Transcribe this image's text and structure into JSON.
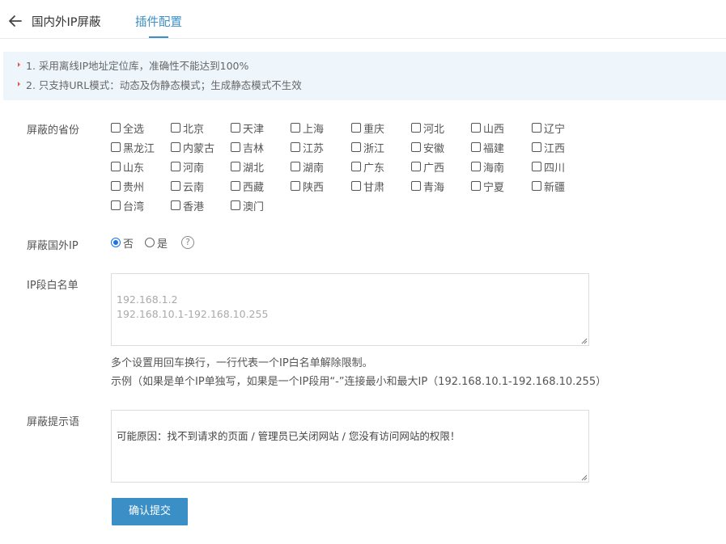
{
  "header": {
    "title": "国内外IP屏蔽",
    "tab_label": "插件配置"
  },
  "notice": {
    "items": [
      "1. 采用离线IP地址定位库，准确性不能达到100%",
      "2. 只支持URL模式：动态及伪静态模式；生成静态模式不生效"
    ]
  },
  "provinces": {
    "label": "屏蔽的省份",
    "options": [
      "全选",
      "北京",
      "天津",
      "上海",
      "重庆",
      "河北",
      "山西",
      "辽宁",
      "黑龙江",
      "内蒙古",
      "吉林",
      "江苏",
      "浙江",
      "安徽",
      "福建",
      "江西",
      "山东",
      "河南",
      "湖北",
      "湖南",
      "广东",
      "广西",
      "海南",
      "四川",
      "贵州",
      "云南",
      "西藏",
      "陕西",
      "甘肃",
      "青海",
      "宁夏",
      "新疆",
      "台湾",
      "香港",
      "澳门"
    ]
  },
  "foreign": {
    "label": "屏蔽国外IP",
    "options": [
      "否",
      "是"
    ],
    "selected": "否",
    "help": "?"
  },
  "whitelist": {
    "label": "IP段白名单",
    "placeholder": "192.168.1.2\n192.168.10.1-192.168.10.255",
    "hint1": "多个设置用回车换行，一行代表一个IP白名单解除限制。",
    "hint2": "示例（如果是单个IP单独写，如果是一个IP段用“-”连接最小和最大IP（192.168.10.1-192.168.10.255）"
  },
  "message": {
    "label": "屏蔽提示语",
    "value": "可能原因：找不到请求的页面 / 管理员已关闭网站 / 您没有访问网站的权限！"
  },
  "submit_label": "确认提交",
  "colors": {
    "accent": "#3a8fc6",
    "notice_bg": "#eef6fc",
    "bullet": "#e05a4f",
    "radio_checked": "#1a73e8"
  }
}
